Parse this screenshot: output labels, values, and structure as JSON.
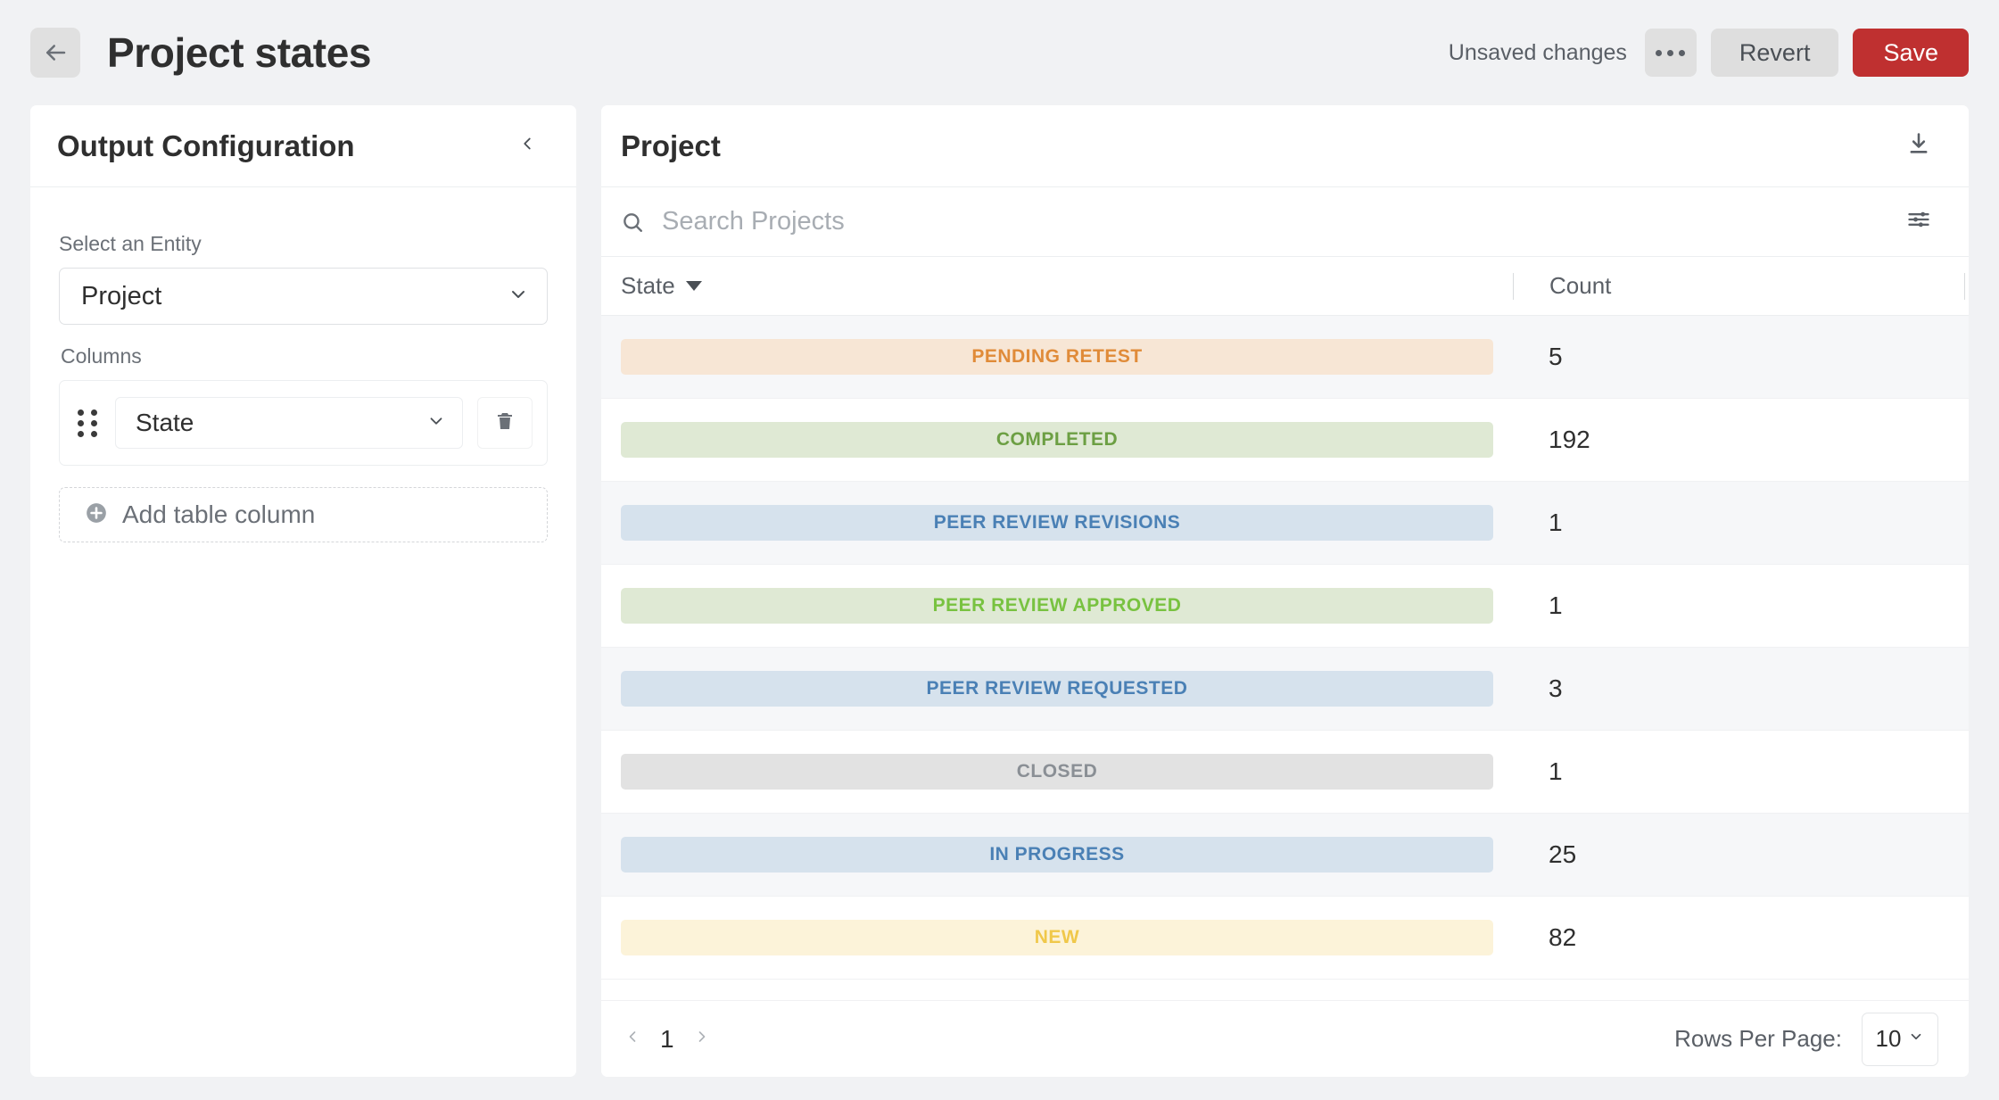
{
  "topbar": {
    "back_icon": "arrow-left-icon",
    "title": "Project states",
    "unsaved_label": "Unsaved changes",
    "more_icon": "ellipsis-icon",
    "revert_label": "Revert",
    "save_label": "Save",
    "save_color": "#bf3030"
  },
  "sidebar": {
    "title": "Output Configuration",
    "collapse_icon": "chevron-left-icon",
    "entity_label": "Select an Entity",
    "entity_value": "Project",
    "columns_label": "Columns",
    "column_rows": [
      {
        "drag_icon": "drag-handle-icon",
        "value": "State",
        "delete_icon": "trash-icon"
      }
    ],
    "add_column_label": "Add table column",
    "add_column_icon": "plus-circle-icon"
  },
  "main": {
    "title": "Project",
    "download_icon": "download-icon",
    "filter_icon": "filter-sliders-icon",
    "search": {
      "icon": "search-icon",
      "placeholder": "Search Projects",
      "value": ""
    },
    "table": {
      "columns": [
        {
          "label": "State",
          "sorted": true,
          "sort_icon": "sort-descending-triangle-icon"
        },
        {
          "label": "Count",
          "sorted": false
        }
      ],
      "rows": [
        {
          "state": "PENDING RETEST",
          "count": "5",
          "pill_bg": "#f7e6d5",
          "pill_fg": "#e08b39"
        },
        {
          "state": "COMPLETED",
          "count": "192",
          "pill_bg": "#dfe9d4",
          "pill_fg": "#6c9f43"
        },
        {
          "state": "PEER REVIEW REVISIONS",
          "count": "1",
          "pill_bg": "#d6e2ed",
          "pill_fg": "#4a80b5"
        },
        {
          "state": "PEER REVIEW APPROVED",
          "count": "1",
          "pill_bg": "#dfe9d4",
          "pill_fg": "#78c240"
        },
        {
          "state": "PEER REVIEW REQUESTED",
          "count": "3",
          "pill_bg": "#d6e2ed",
          "pill_fg": "#4a80b5"
        },
        {
          "state": "CLOSED",
          "count": "1",
          "pill_bg": "#e2e2e2",
          "pill_fg": "#8a8f95"
        },
        {
          "state": "IN PROGRESS",
          "count": "25",
          "pill_bg": "#d6e2ed",
          "pill_fg": "#4a80b5"
        },
        {
          "state": "NEW",
          "count": "82",
          "pill_bg": "#fcf3d9",
          "pill_fg": "#f0c84a"
        }
      ]
    },
    "footer": {
      "prev_icon": "chevron-left-icon",
      "page": "1",
      "next_icon": "chevron-right-icon",
      "rows_per_page_label": "Rows Per Page:",
      "rows_per_page_value": "10",
      "rows_per_page_icon": "chevron-down-icon"
    }
  }
}
